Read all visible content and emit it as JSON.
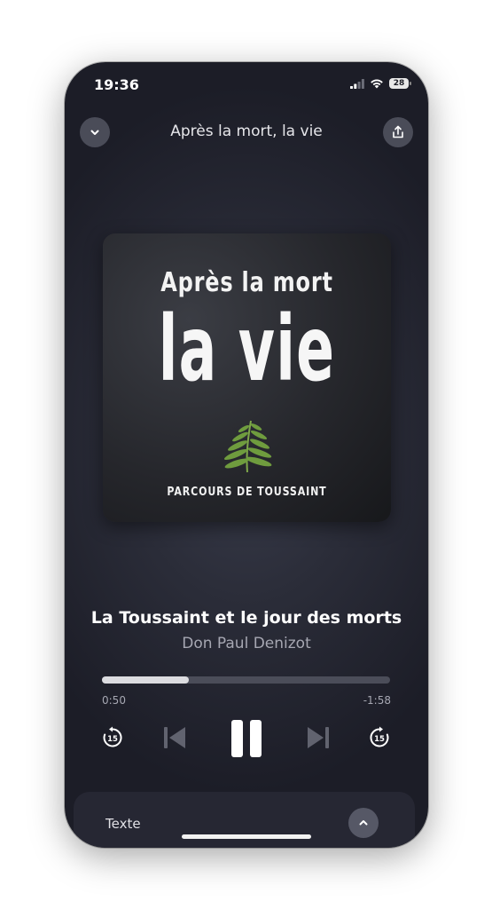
{
  "status_bar": {
    "time": "19:36",
    "battery": "28"
  },
  "header": {
    "title": "Après la mort, la vie"
  },
  "cover": {
    "line1": "Après la mort",
    "line2": "la vie",
    "line3": "PARCOURS DE TOUSSAINT"
  },
  "track": {
    "title": "La Toussaint et le jour des morts",
    "artist": "Don Paul Denizot"
  },
  "playback": {
    "elapsed": "0:50",
    "remaining": "-1:58",
    "progress_fraction": 0.3,
    "skip_seconds": "15"
  },
  "bottom_sheet": {
    "label": "Texte"
  },
  "icons": {
    "collapse": "chevron-down-icon",
    "share": "share-icon",
    "rewind": "rewind-15-icon",
    "previous": "previous-track-icon",
    "pause": "pause-icon",
    "next": "next-track-icon",
    "forward": "forward-15-icon",
    "expand": "chevron-up-icon"
  },
  "colors": {
    "background": "#2b2d39",
    "accent": "#dcdce0"
  }
}
